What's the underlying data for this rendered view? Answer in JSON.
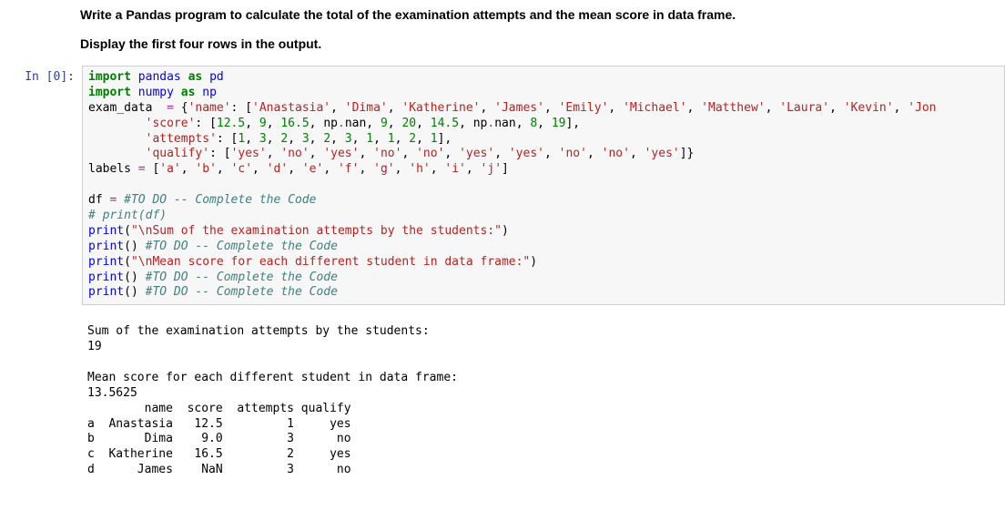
{
  "heading1": "Write a Pandas program to calculate the total of the examination attempts and the mean score in data frame.",
  "heading2": "Display the first four rows in the output.",
  "prompt_label": "In [0]:",
  "code": {
    "l1": {
      "kw1": "import",
      "mod1": "pandas",
      "kw2": "as",
      "alias1": "pd"
    },
    "l2": {
      "kw1": "import",
      "mod1": "numpy",
      "kw2": "as",
      "alias1": "np"
    },
    "l3a": "exam_data  ",
    "l3eq": "=",
    "l3b": " {",
    "l3k1": "'name'",
    "l3c": ": [",
    "l3v1": "'Anastasia'",
    "l3v2": "'Dima'",
    "l3v3": "'Katherine'",
    "l3v4": "'James'",
    "l3v5": "'Emily'",
    "l3v6": "'Michael'",
    "l3v7": "'Matthew'",
    "l3v8": "'Laura'",
    "l3v9": "'Kevin'",
    "l3v10": "'Jon",
    "l4pad": "        ",
    "l4k": "'score'",
    "l4c": ": [",
    "l4n1": "12.5",
    "l4n2": "9",
    "l4n3": "16.5",
    "l4nan1": "np",
    "l4nan1b": "nan",
    "l4n4": "9",
    "l4n5": "20",
    "l4n6": "14.5",
    "l4nan2": "np",
    "l4nan2b": "nan",
    "l4n7": "8",
    "l4n8": "19",
    "l4end": "],",
    "l5pad": "        ",
    "l5k": "'attempts'",
    "l5c": ": [",
    "l5n": [
      "1",
      "3",
      "2",
      "3",
      "2",
      "3",
      "1",
      "1",
      "2",
      "1"
    ],
    "l5end": "],",
    "l6pad": "        ",
    "l6k": "'qualify'",
    "l6c": ": [",
    "l6v": [
      "'yes'",
      "'no'",
      "'yes'",
      "'no'",
      "'no'",
      "'yes'",
      "'yes'",
      "'no'",
      "'no'",
      "'yes'"
    ],
    "l6end": "]}",
    "l7a": "labels ",
    "l7eq": "=",
    "l7b": " [",
    "l7v": [
      "'a'",
      "'b'",
      "'c'",
      "'d'",
      "'e'",
      "'f'",
      "'g'",
      "'h'",
      "'i'",
      "'j'"
    ],
    "l7end": "]",
    "l9a": "df ",
    "l9eq": "=",
    "l9c": " #TO DO -- Complete the Code",
    "l10": "# print(df)",
    "l11a": "print",
    "l11b": "(",
    "l11s": "\"\\nSum of the examination attempts by the students:\"",
    "l11c": ")",
    "l12a": "print",
    "l12b": "() ",
    "l12c": "#TO DO -- Complete the Code",
    "l13a": "print",
    "l13b": "(",
    "l13s": "\"\\nMean score for each different student in data frame:\"",
    "l13c": ")",
    "l14a": "print",
    "l14b": "() ",
    "l14c": "#TO DO -- Complete the Code",
    "l15a": "print",
    "l15b": "() ",
    "l15c": "#TO DO -- Complete the Code"
  },
  "output": {
    "blank0": "",
    "line1": "Sum of the examination attempts by the students:",
    "line2": "19",
    "blank1": "",
    "line3": "Mean score for each different student in data frame:",
    "line4": "13.5625",
    "hdr": "        name  score  attempts qualify",
    "r1": "a  Anastasia   12.5         1     yes",
    "r2": "b       Dima    9.0         3      no",
    "r3": "c  Katherine   16.5         2     yes",
    "r4": "d      James    NaN         3      no"
  }
}
